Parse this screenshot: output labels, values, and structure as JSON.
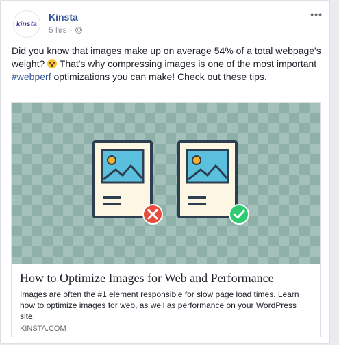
{
  "post": {
    "page_name": "Kinsta",
    "avatar_text": "kinsta",
    "time": "5 hrs",
    "separator": "·",
    "more_icon": "•••",
    "text_part1": "Did you know that images make up on average 54% of a total webpage's weight?",
    "text_part2": "That's why compressing images is one of the most important",
    "hashtag": "#webperf",
    "text_part3": "optimizations you can make! Check out these tips."
  },
  "link": {
    "title": "How to Optimize Images for Web and Performance",
    "description": "Images are often the #1 element responsible for slow page load times. Learn how to optimize images for web, as well as performance on your WordPress site.",
    "domain": "KINSTA.COM"
  },
  "illustration": {
    "bad_caption": "",
    "good_caption": "",
    "colors": {
      "frame": "#2c3e50",
      "sky": "#5bc0de",
      "sun": "#f5b12c",
      "bad": "#e74c3c",
      "good": "#2ecc71"
    }
  }
}
